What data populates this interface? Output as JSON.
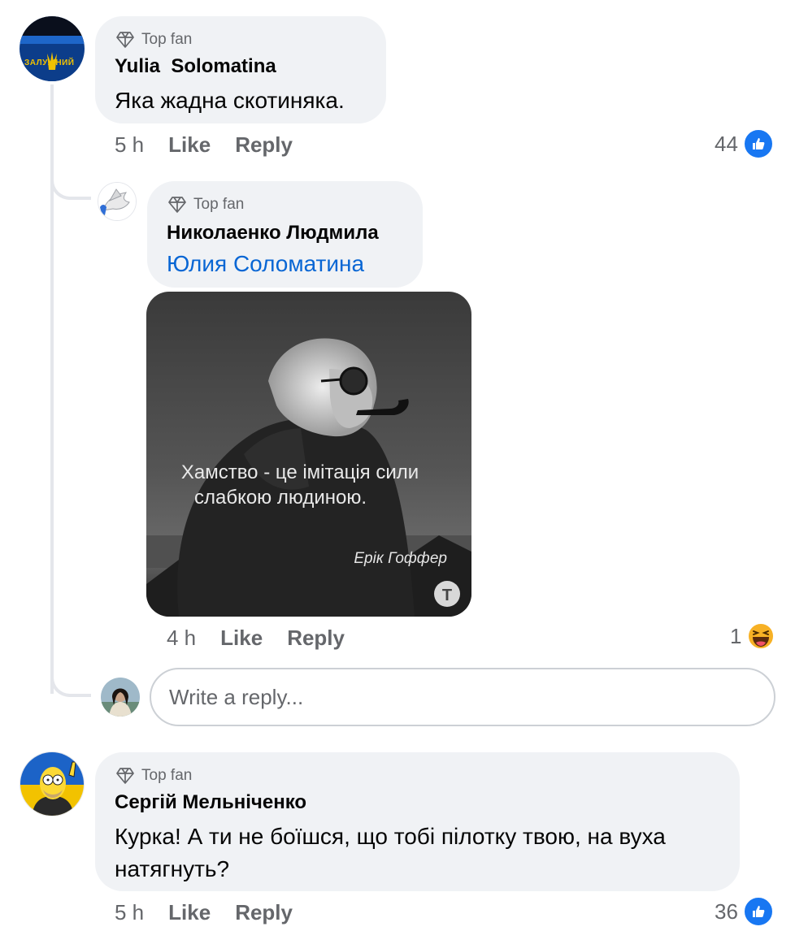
{
  "comments": [
    {
      "badge": "Top fan",
      "author": "Yulia  Solomatina",
      "text": "Яка жадна скотиняка.",
      "avatar_text": "ЗАЛУЖНИЙ",
      "time": "5 h",
      "like_label": "Like",
      "reply_label": "Reply",
      "reaction_count": "44",
      "reaction_icon": "thumbs-up-icon"
    },
    {
      "badge": "Top fan",
      "author": "Сергій Мельніченко",
      "text": "Курка! А ти не боїшся, що тобі пілотку твою, на вуха натягнуть?",
      "time": "5 h",
      "like_label": "Like",
      "reply_label": "Reply",
      "reaction_count": "36",
      "reaction_icon": "thumbs-up-icon"
    }
  ],
  "reply": {
    "badge": "Top fan",
    "author": "Николаенко Людмила",
    "mention": "Юлия Соломатина",
    "image": {
      "quote_line1": "Хамство - це імітація сили",
      "quote_line2": "слабкою людиною.",
      "quote_author": "Ерік Гоффер",
      "watermark": "T"
    },
    "time": "4 h",
    "like_label": "Like",
    "reply_label": "Reply",
    "reaction_count": "1",
    "reaction_icon": "haha-emoji-icon"
  },
  "reply_input": {
    "placeholder": "Write a reply..."
  },
  "colors": {
    "bubble": "#f0f2f5",
    "secondary_text": "#65676b",
    "link": "#0866d4",
    "like_blue": "#1877f2"
  }
}
